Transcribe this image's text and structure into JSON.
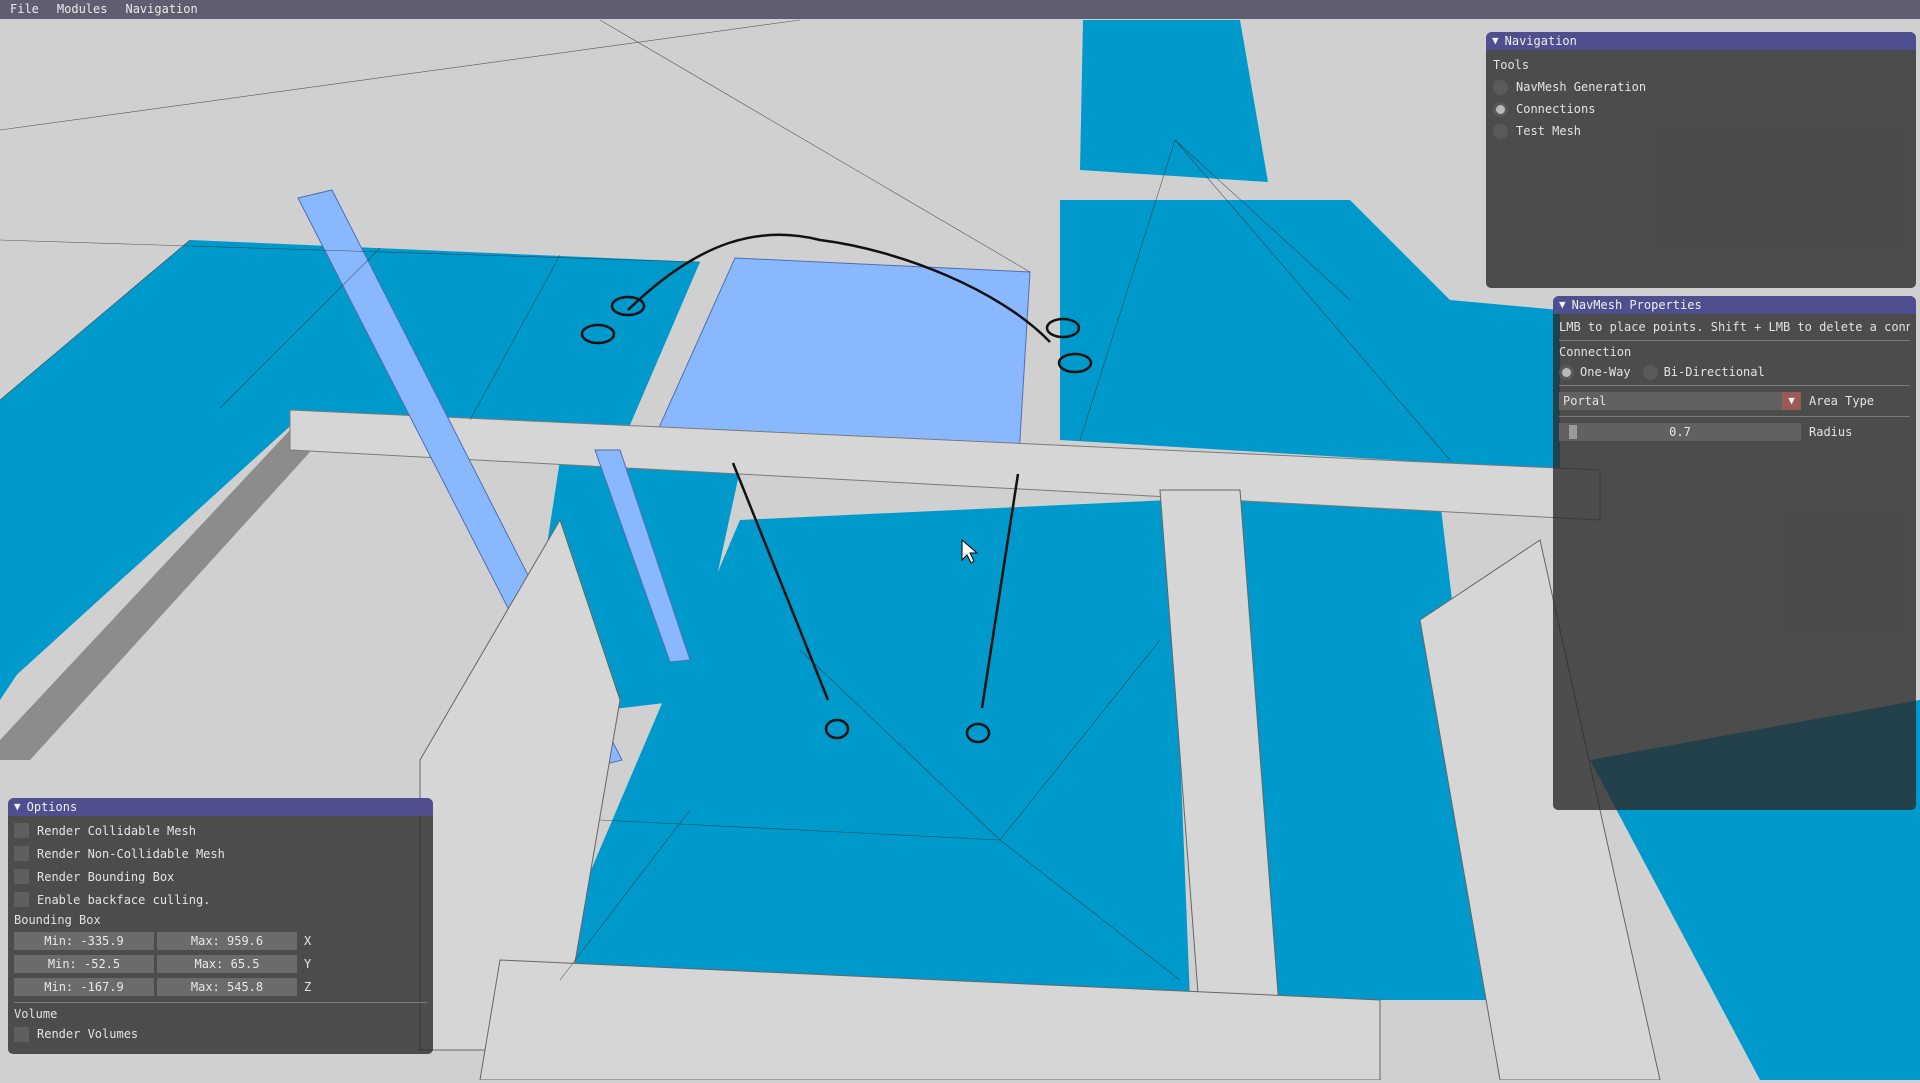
{
  "menubar": {
    "items": [
      "File",
      "Modules",
      "Navigation"
    ]
  },
  "navigation_panel": {
    "title": "Navigation",
    "tools_label": "Tools",
    "tools": [
      {
        "label": "NavMesh Generation",
        "selected": false
      },
      {
        "label": "Connections",
        "selected": true
      },
      {
        "label": "Test Mesh",
        "selected": false
      }
    ]
  },
  "navmesh_panel": {
    "title": "NavMesh Properties",
    "hint": "LMB to place points. Shift + LMB to delete a conne",
    "connection_label": "Connection",
    "direction_options": [
      {
        "label": "One-Way",
        "selected": true
      },
      {
        "label": "Bi-Directional",
        "selected": false
      }
    ],
    "area_type_value": "Portal",
    "area_type_label": "Area Type",
    "radius_value": "0.7",
    "radius_label": "Radius"
  },
  "options_panel": {
    "title": "Options",
    "checkboxes": [
      {
        "label": "Render Collidable Mesh",
        "checked": false
      },
      {
        "label": "Render Non-Collidable Mesh",
        "checked": false
      },
      {
        "label": "Render Bounding Box",
        "checked": false
      },
      {
        "label": "Enable backface culling.",
        "checked": false
      }
    ],
    "bbox_label": "Bounding Box",
    "bbox_rows": [
      {
        "min": "Min: -335.9",
        "max": "Max: 959.6",
        "axis": "X"
      },
      {
        "min": "Min: -52.5",
        "max": "Max: 65.5",
        "axis": "Y"
      },
      {
        "min": "Min: -167.9",
        "max": "Max: 545.8",
        "axis": "Z"
      }
    ],
    "volume_label": "Volume",
    "render_volumes_label": "Render Volumes"
  },
  "colors": {
    "navmesh_blue": "#0099cc",
    "selected_poly": "#8ab8ff",
    "geometry_gray": "#cfcfcf",
    "title_bar": "#4f4f8f",
    "menubar": "#5e5e70"
  }
}
